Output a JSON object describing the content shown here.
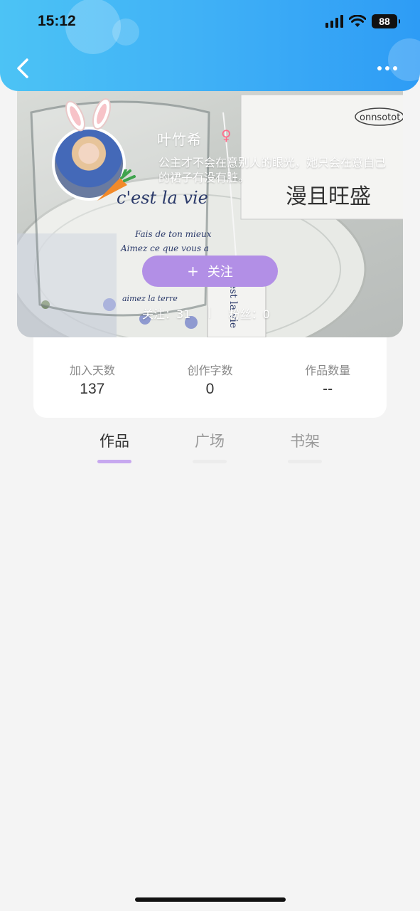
{
  "status_bar": {
    "time": "15:12",
    "battery": "88"
  },
  "profile": {
    "nickname": "叶竹希",
    "gender_symbol": "♀",
    "bio": "公主才不会在意别人的眼光，她只会在意自己的裙子有没有脏。",
    "follow_label": "关注",
    "follow_plus": "+",
    "following": "关注：31",
    "followers": "粉丝：0",
    "photo_text": {
      "cup_line1": "c'est la vie",
      "cup_line2": "Fais de ton mieux",
      "cup_line3": "Aimez ce que vous a",
      "cup_line4": "aimez la terre",
      "box_brand": "onnsotot",
      "box_text": "漫且旺盛",
      "tag_text": "c'est la vie"
    }
  },
  "stats": [
    {
      "label": "加入天数",
      "value": "137"
    },
    {
      "label": "创作字数",
      "value": "0"
    },
    {
      "label": "作品数量",
      "value": "--"
    }
  ],
  "tabs": [
    {
      "label": "作品",
      "active": true
    },
    {
      "label": "广场",
      "active": false
    },
    {
      "label": "书架",
      "active": false
    }
  ],
  "colors": {
    "header_start": "#4cc3f5",
    "header_end": "#2e9cf5",
    "accent": "#b28fe6",
    "tab_indicator": "#c7a8ef"
  }
}
